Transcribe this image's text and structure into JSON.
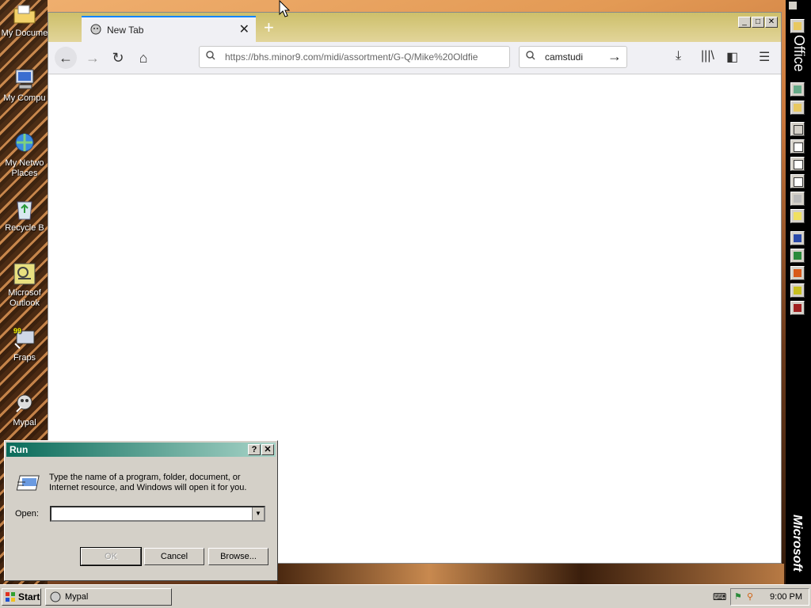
{
  "desktop": {
    "icons": [
      {
        "label": "My Docume",
        "icon": "folder-documents-icon"
      },
      {
        "label": "My Compu",
        "icon": "computer-icon"
      },
      {
        "label": "My Netwo Places",
        "icon": "network-icon"
      },
      {
        "label": "Recycle B",
        "icon": "recycle-bin-icon"
      },
      {
        "label": "Microsof Outlook",
        "icon": "outlook-icon"
      },
      {
        "label": "Fraps",
        "icon": "fraps-icon"
      },
      {
        "label": "Mypal",
        "icon": "mypal-icon"
      }
    ]
  },
  "browser": {
    "tab_title": "New Tab",
    "url": "https://bhs.minor9.com/midi/assortment/G-Q/Mike%20Oldfie",
    "search_value": "camstudi",
    "colors": {
      "tabbar": "#cdbf6a",
      "accent": "#0a84ff"
    }
  },
  "office_bar": {
    "title": "Office",
    "brand": "Microsoft"
  },
  "run_dialog": {
    "title": "Run",
    "help_label": "?",
    "close_label": "✕",
    "description": "Type the name of a program, folder, document, or Internet resource, and Windows will open it for you.",
    "open_label": "Open:",
    "open_value": "",
    "ok_label": "OK",
    "cancel_label": "Cancel",
    "browse_label": "Browse..."
  },
  "taskbar": {
    "start_label": "Start",
    "item_label": "Mypal",
    "clock": "9:00 PM"
  }
}
